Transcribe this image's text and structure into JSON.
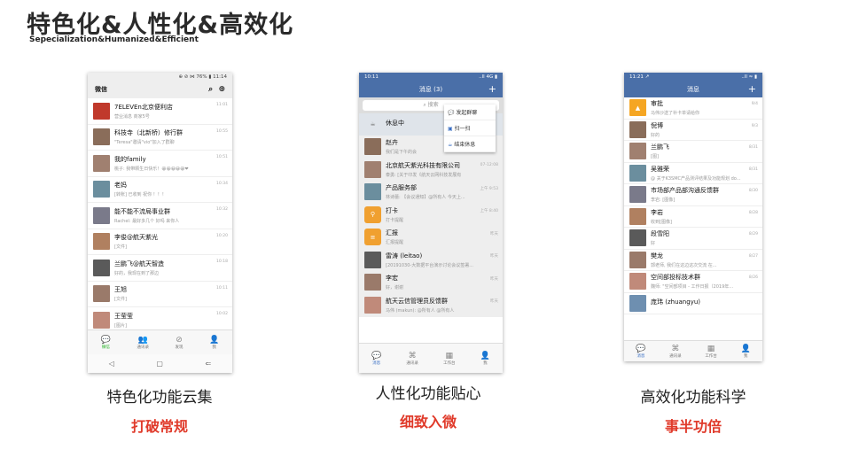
{
  "title": "特色化&人性化&高效化",
  "subtitle": "Sepecialization&Humanized&Efficient",
  "col1": {
    "caption": "特色化功能云集",
    "highlight": "打破常规"
  },
  "col2": {
    "caption": "人性化功能贴心",
    "highlight": "细致入微"
  },
  "col3": {
    "caption": "高效化功能科学",
    "highlight": "事半功倍"
  },
  "p1": {
    "status": "⊕ ⊘ ⋈ 76% ▮ 11:14",
    "header": "微信",
    "rows": [
      {
        "n": "7ELEVEn北京便利店",
        "p": "营业消息 商家5号",
        "t": "11:01"
      },
      {
        "n": "科技寺（北新桥）修行群",
        "p": "\"Teresa\"邀请\"vio\"加入了群聊",
        "t": "10:55"
      },
      {
        "n": "我的family",
        "p": "桃子: 我带颗生日快乐！😀😀😀😀😀❤",
        "t": "10:51"
      },
      {
        "n": "老妈",
        "p": "[转账] 已收到 祝你 ！！！",
        "t": "10:34"
      },
      {
        "n": "能不能不流局事业群",
        "p": "Rachel: 最好多几个 好吗 来你人",
        "t": "10:32"
      },
      {
        "n": "李俊@航天紫光",
        "p": "[文件]",
        "t": "10:20"
      },
      {
        "n": "兰鹏飞@航天智造",
        "p": "好的，我现在到了那边",
        "t": "10:18"
      },
      {
        "n": "王旭",
        "p": "[文件]",
        "t": "10:11"
      },
      {
        "n": "王莹莹",
        "p": "[图片]",
        "t": "10:02"
      }
    ],
    "tabs": [
      "微信",
      "通讯录",
      "发现",
      "我"
    ],
    "nav": [
      "◁",
      "▢",
      "⇐"
    ]
  },
  "p2": {
    "status": "10:11",
    "status_r": "..ll 4G ▮",
    "header": "消息 (3)",
    "search": "搜索",
    "menu": [
      "发起群聊",
      "扫一扫",
      "结束休息"
    ],
    "rows": [
      {
        "n": "休息中",
        "p": "",
        "t": ""
      },
      {
        "n": "赵卉",
        "p": "我们是下午的会",
        "t": ""
      },
      {
        "n": "北京航天紫光科技有限公司",
        "p": "泰勇: [关于印发《航天云网科技发展有",
        "t": "07-12:08"
      },
      {
        "n": "产品服务部",
        "p": "林诗蕾: 【会议通知】@所有人 今天上...",
        "t": "上午 9:53"
      },
      {
        "n": "打卡",
        "p": "打卡提醒",
        "t": "上午 8:40"
      },
      {
        "n": "汇报",
        "p": "汇报提醒",
        "t": "昨天"
      },
      {
        "n": "雷涛 (leitao)",
        "p": "[20191030-大数据平台演示讨论会议签署...",
        "t": "昨天"
      },
      {
        "n": "李宏",
        "p": "好，谢谢",
        "t": "昨天"
      },
      {
        "n": "航天云信管理员反馈群",
        "p": "马伟 (makun): @所有人 @所有人",
        "t": "昨天"
      }
    ],
    "tabs": [
      "消息",
      "通讯录",
      "工作台",
      "我"
    ]
  },
  "p3": {
    "status": "11:21 ↗",
    "status_r": "..ll ≈ ▮",
    "header": "消息",
    "rows": [
      {
        "n": "审批",
        "p": "马伟沙送了补卡单请给你",
        "t": "9/4"
      },
      {
        "n": "倪博",
        "p": "好的",
        "t": "9/3"
      },
      {
        "n": "兰鹏飞",
        "p": "[图]",
        "t": "8/31"
      },
      {
        "n": "吴雅荣",
        "p": "@ 关于K3SMC产品测评结果及功能规划 do...",
        "t": "8/31"
      },
      {
        "n": "市场部产品部沟通反馈群",
        "p": "李岩: [图像]",
        "t": "8/30"
      },
      {
        "n": "李岩",
        "p": "收到[图像]",
        "t": "8/28"
      },
      {
        "n": "段雪阳",
        "p": "好",
        "t": "8/29"
      },
      {
        "n": "樊龙",
        "p": "郭老师, 我们在这边这次交流 在...",
        "t": "8/27"
      },
      {
        "n": "空间部投标技术群",
        "p": "魏师: \"空间部项目 - 工作日报（2019年...",
        "t": "8/26"
      },
      {
        "n": "庞玮 (zhuangyu)",
        "p": "",
        "t": ""
      }
    ],
    "tabs": [
      "消息",
      "通讯录",
      "工作台",
      "我"
    ]
  }
}
